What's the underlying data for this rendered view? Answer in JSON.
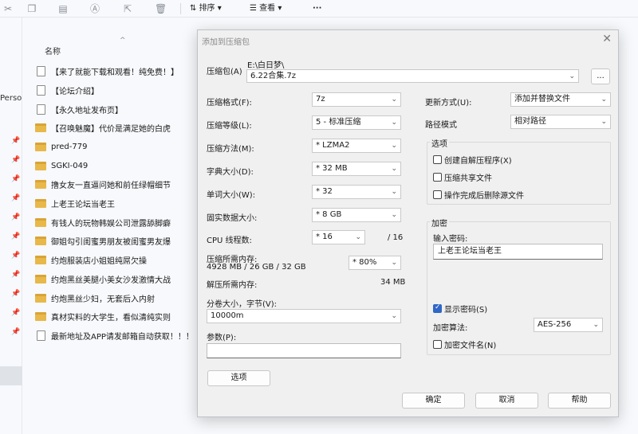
{
  "toolbar": {
    "sort_label": "排序",
    "view_label": "查看",
    "more_label": "···"
  },
  "explorer": {
    "nav_partial_label": "Perso",
    "column_header": "名称",
    "files": [
      {
        "name": "【来了就能下载和观看！纯免费！】",
        "type": "doc"
      },
      {
        "name": "【论坛介绍】",
        "type": "doc"
      },
      {
        "name": "【永久地址发布页】",
        "type": "doc"
      },
      {
        "name": "【召唤魅魔】代价是满足她的白虎",
        "type": "folder"
      },
      {
        "name": "pred-779",
        "type": "folder"
      },
      {
        "name": "SGKI-049",
        "type": "folder"
      },
      {
        "name": "撸女友一直逼问她和前任绿帽细节",
        "type": "folder"
      },
      {
        "name": "上老王论坛当老王",
        "type": "folder"
      },
      {
        "name": "有钱人的玩物韩娱公司泄露舔脚癖",
        "type": "folder"
      },
      {
        "name": "御姐勾引闺蜜男朋友被闺蜜男友爆",
        "type": "folder"
      },
      {
        "name": "约炮服装店小姐姐纯屌欠操",
        "type": "folder"
      },
      {
        "name": "约炮黑丝美腿小美女沙发激情大战",
        "type": "folder"
      },
      {
        "name": "约炮黑丝少妇，无套后入内射",
        "type": "folder"
      },
      {
        "name": "真材实料的大学生，看似清纯实则",
        "type": "folder"
      },
      {
        "name": "最新地址及APP请发邮箱自动获取！！！",
        "type": "doc"
      }
    ]
  },
  "dialog": {
    "title": "添加到压缩包",
    "archive_label": "压缩包(A)",
    "archive_path": "E:\\白日梦\\",
    "archive_name": "6.22合集.7z",
    "browse_label": "...",
    "format_label": "压缩格式(F):",
    "format_value": "7z",
    "level_label": "压缩等级(L):",
    "level_value": "5 - 标准压缩",
    "method_label": "压缩方法(M):",
    "method_value": "*  LZMA2",
    "dict_label": "字典大小(D):",
    "dict_value": "*  32 MB",
    "word_label": "单词大小(W):",
    "word_value": "*  32",
    "solid_label": "固实数据大小:",
    "solid_value": "*  8 GB",
    "threads_label": "CPU 线程数:",
    "threads_value": "*  16",
    "threads_max": "/ 16",
    "mem_comp_label": "压缩所需内存:",
    "mem_comp_value": "4928 MB / 26 GB / 32 GB",
    "mem_pct_value": "*  80%",
    "mem_decomp_label": "解压所需内存:",
    "mem_decomp_value": "34 MB",
    "split_label": "分卷大小，字节(V):",
    "split_value": "10000m",
    "params_label": "参数(P):",
    "params_value": "",
    "options_button": "选项",
    "update_label": "更新方式(U):",
    "update_value": "添加并替换文件",
    "path_mode_label": "路径模式",
    "path_mode_value": "相对路径",
    "options_group": "选项",
    "opt_sfx": "创建自解压程序(X)",
    "opt_shared": "压缩共享文件",
    "opt_delete": "操作完成后删除源文件",
    "encrypt_group": "加密",
    "password_label": "输入密码:",
    "password_value": "上老王论坛当老王",
    "show_password": "显示密码(S)",
    "enc_method_label": "加密算法:",
    "enc_method_value": "AES-256",
    "encrypt_names": "加密文件名(N)",
    "ok_label": "确定",
    "cancel_label": "取消",
    "help_label": "帮助"
  }
}
